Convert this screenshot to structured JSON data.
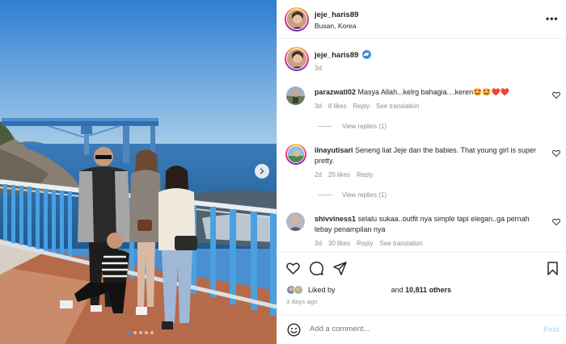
{
  "post": {
    "author": "jeje_haris89",
    "location": "Busan, Korea",
    "more_label": "•••",
    "caption_time": "3d",
    "carousel": {
      "total": 5,
      "active": 1
    }
  },
  "comments": [
    {
      "user": "parazwati02",
      "text": "Masya Allah...kelrg bahagia....keren🤩🤩❤️❤️",
      "time": "3d",
      "likes": "8 likes",
      "reply": "Reply",
      "translate": "See translation",
      "view_replies": "View replies (1)"
    },
    {
      "user": "ilnayutisari",
      "text": "Seneng liat Jeje dan the babies. That young girl is super pretty.",
      "time": "2d",
      "likes": "20 likes",
      "reply": "Reply",
      "translate": "",
      "view_replies": "View replies (1)"
    },
    {
      "user": "shivviness1",
      "text": "selalu sukaa..outfit nya simple tapi elegan..ga pernah lebay penampilan nya",
      "time": "3d",
      "likes": "30 likes",
      "reply": "Reply",
      "translate": "See translation",
      "view_replies": ""
    }
  ],
  "likes": {
    "prefix": "Liked by",
    "suffix_and": "and",
    "others": "10,811 others"
  },
  "ago": "3 days ago",
  "add_comment": {
    "placeholder": "Add a comment...",
    "post_label": "Post"
  },
  "colors": {
    "link_blue": "#3897f0",
    "post_disabled": "#b2dffc",
    "meta_gray": "#8e8e8e"
  },
  "icons": [
    "chevron-right-icon",
    "more-icon",
    "wave-emoji-icon",
    "heart-icon",
    "comment-icon",
    "share-icon",
    "bookmark-icon",
    "smile-icon"
  ]
}
